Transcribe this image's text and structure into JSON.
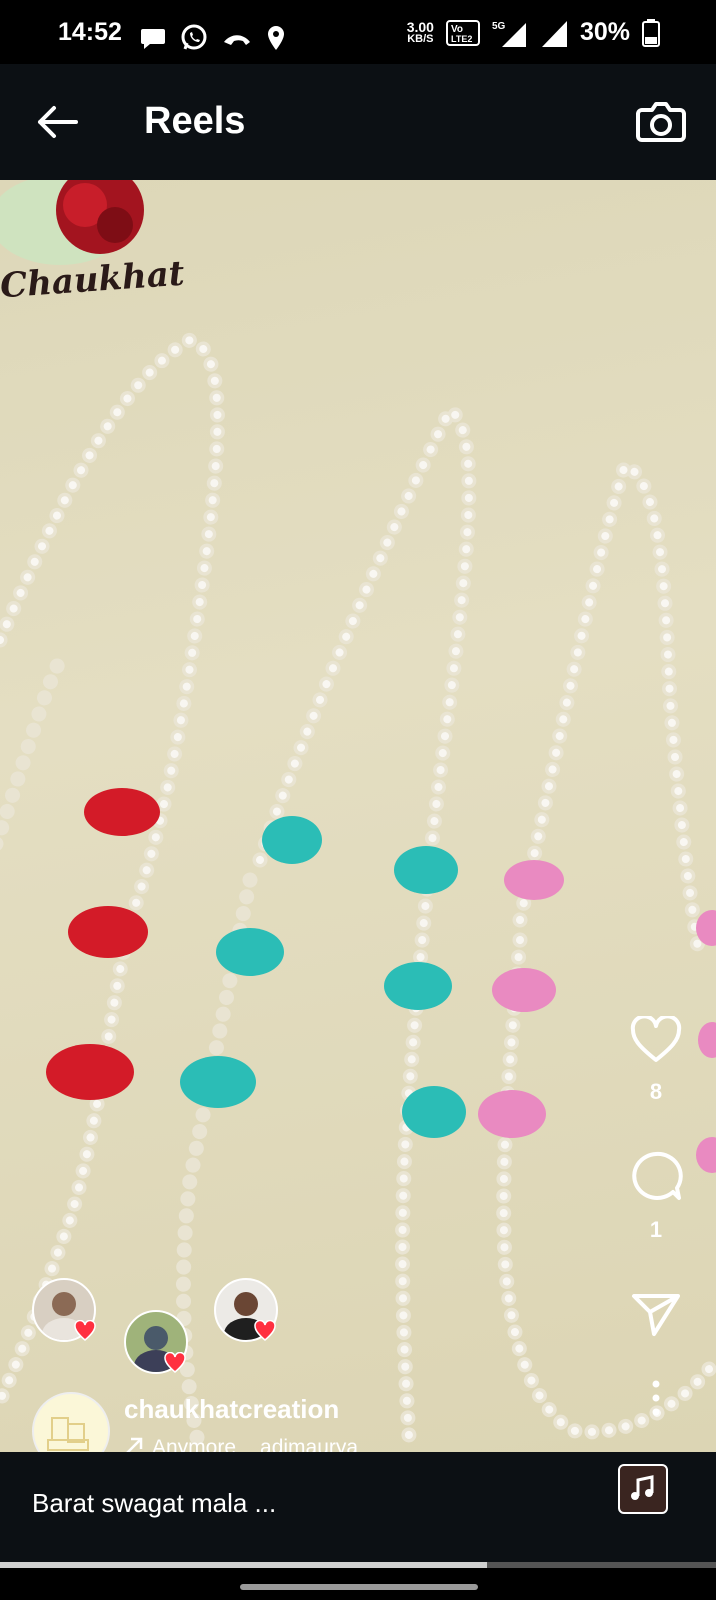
{
  "status_bar": {
    "time": "14:52",
    "speed_value": "3.00",
    "speed_unit": "KB/S",
    "volte": "Vo LTE2",
    "network": "5G",
    "battery": "30%",
    "icons": [
      "chat-bubble-icon",
      "whatsapp-icon",
      "missed-call-icon",
      "location-icon",
      "volte-icon",
      "signal-icon",
      "battery-icon"
    ]
  },
  "header": {
    "title": "Reels",
    "back_icon": "back-arrow-icon",
    "camera_icon": "camera-icon"
  },
  "reel": {
    "watermark": "Chaukhat",
    "actions": {
      "like_count": "8",
      "comment_count": "1"
    },
    "user": {
      "username": "chaukhatcreation",
      "audio_label": "Anymore",
      "audio_artist": "adimaurya"
    },
    "likers": [
      "liker-1",
      "liker-2",
      "liker-3"
    ]
  },
  "caption": {
    "text": "Barat swagat mala ..."
  },
  "progress": {
    "fraction": 0.68
  },
  "colors": {
    "background": "#0c1014",
    "accent_heart": "#ff3040"
  }
}
